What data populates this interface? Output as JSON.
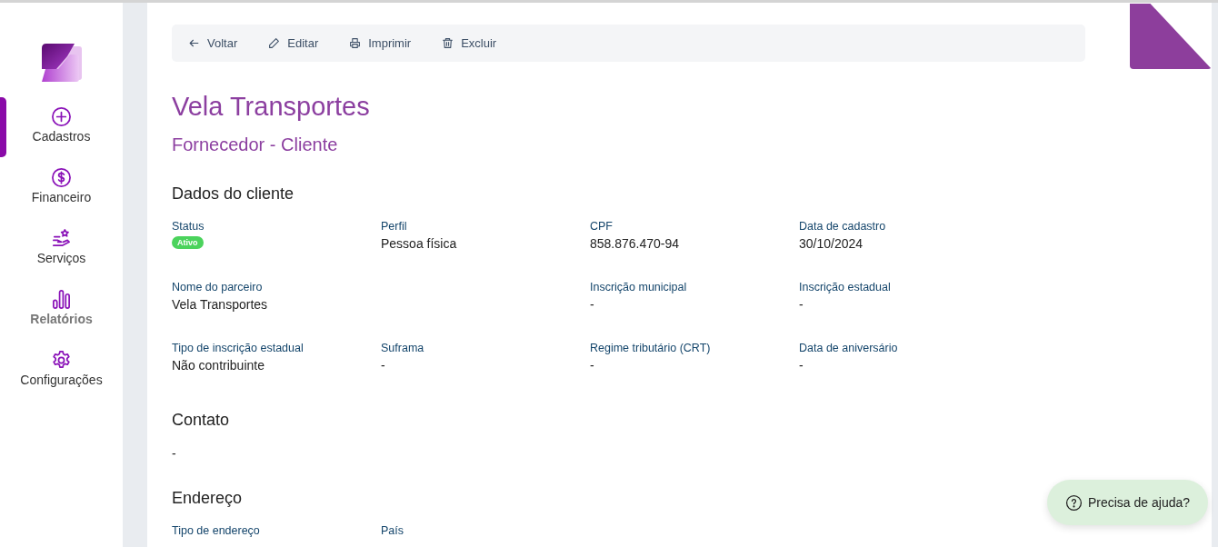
{
  "sidebar": {
    "items": [
      {
        "label": "Cadastros",
        "selected": true,
        "muted": false
      },
      {
        "label": "Financeiro",
        "selected": false,
        "muted": false
      },
      {
        "label": "Serviços",
        "selected": false,
        "muted": false
      },
      {
        "label": "Relatórios",
        "selected": false,
        "muted": true
      },
      {
        "label": "Configurações",
        "selected": false,
        "muted": false
      }
    ]
  },
  "toolbar": [
    {
      "label": "Voltar"
    },
    {
      "label": "Editar"
    },
    {
      "label": "Imprimir"
    },
    {
      "label": "Excluir"
    }
  ],
  "title": "Vela Transportes",
  "subtitle": "Fornecedor - Cliente",
  "sections": [
    {
      "heading": "Dados do cliente",
      "rows": [
        [
          {
            "label": "Status",
            "value": "Ativo",
            "kind": "badge"
          },
          {
            "label": "Perfil",
            "value": "Pessoa física",
            "kind": "text"
          },
          {
            "label": "CPF",
            "value": "858.876.470-94",
            "kind": "text"
          },
          {
            "label": "Data de cadastro",
            "value": "30/10/2024",
            "kind": "text"
          }
        ],
        [
          {
            "label": "Nome do parceiro",
            "value": "Vela Transportes",
            "kind": "text"
          },
          null,
          {
            "label": "Inscrição municipal",
            "value": "-",
            "kind": "text"
          },
          {
            "label": "Inscrição estadual",
            "value": "-",
            "kind": "text"
          }
        ],
        [
          {
            "label": "Tipo de inscrição estadual",
            "value": "Não contribuinte",
            "kind": "text"
          },
          {
            "label": "Suframa",
            "value": "-",
            "kind": "text"
          },
          {
            "label": "Regime tributário (CRT)",
            "value": "-",
            "kind": "text"
          },
          {
            "label": "Data de aniversário",
            "value": "-",
            "kind": "text"
          }
        ]
      ]
    },
    {
      "heading": "Contato",
      "text": "-"
    },
    {
      "heading": "Endereço",
      "rows": [
        [
          {
            "label": "Tipo de endereço",
            "kind": "cut"
          },
          {
            "label": "País",
            "kind": "cut"
          }
        ]
      ]
    }
  ],
  "help_button": {
    "label": "Precisa de ajuda?"
  }
}
